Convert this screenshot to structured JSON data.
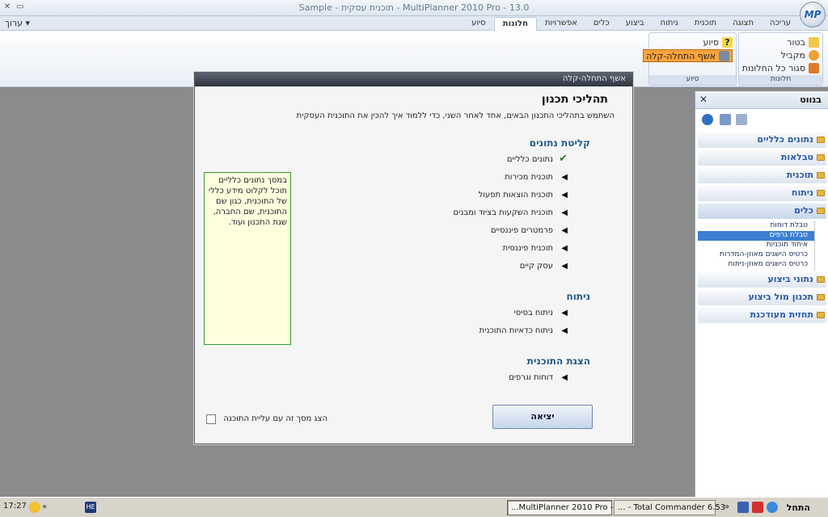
{
  "window": {
    "title": "Sample - תוכנית עסקית - MultiPlanner 2010 Pro - 13.0",
    "min_glyph": "▭",
    "close_glyph": "✕",
    "logo_text": "MP"
  },
  "menu": {
    "edit_label": "ערוך ▾"
  },
  "tabs": [
    {
      "label": "עריכה",
      "active": false
    },
    {
      "label": "תצוגה",
      "active": false
    },
    {
      "label": "תוכנית",
      "active": false
    },
    {
      "label": "ניתוח",
      "active": false
    },
    {
      "label": "ביצוע",
      "active": false
    },
    {
      "label": "כלים",
      "active": false
    },
    {
      "label": "אפשרויות",
      "active": false
    },
    {
      "label": "חלונות",
      "active": true
    },
    {
      "label": "סיוע",
      "active": false
    }
  ],
  "ribbon": {
    "windows_group": {
      "label": "חלונות",
      "items": [
        "בטור",
        "מקביל",
        "סגור כל החלונות"
      ]
    },
    "help_group": {
      "label": "סיוע",
      "items": [
        "סיוע",
        "אשף התחלה-קלה"
      ]
    }
  },
  "pane": {
    "title": "בנווט",
    "close_glyph": "✕",
    "groups": [
      {
        "label": "נתונים כלליים"
      },
      {
        "label": "טבלאות"
      },
      {
        "label": "תוכנית"
      },
      {
        "label": "ניתוח"
      },
      {
        "label": "כלים",
        "open": true
      }
    ],
    "sub_items": [
      {
        "label": "טבלת דוחות",
        "selected": false
      },
      {
        "label": "טבלת גרפים",
        "selected": true
      },
      {
        "label": "איחוד תוכניות",
        "selected": false
      },
      {
        "label": "כרטיס הישגים מאוזן-המדרות",
        "selected": false
      },
      {
        "label": "כרטיס הישגים מאוזן-ניתוח",
        "selected": false
      }
    ],
    "groups_after": [
      {
        "label": "נתוני ביצוע"
      },
      {
        "label": "תכנון מול ביצוע"
      },
      {
        "label": "תחזית מעודכנת"
      }
    ]
  },
  "dialog": {
    "title": "אשף התחלה-קלה",
    "heading": "תהליכי תכנון",
    "intro": "השתמש בתהליכי התכנון הבאים, אחד לאחר השני, כדי ללמוד איך להכין את התוכנית העסקית",
    "sections": [
      {
        "title": "קליטת נתונים",
        "steps": [
          {
            "label": "נתונים כלליים",
            "done": true
          },
          {
            "label": "תוכנית מכירות",
            "done": false
          },
          {
            "label": "תוכנית הוצאות תפעול",
            "done": false
          },
          {
            "label": "תוכנית השקעות בציוד ומבנים",
            "done": false
          },
          {
            "label": "פרמטרים פיננסיים",
            "done": false
          },
          {
            "label": "תוכנית פיננסית",
            "done": false
          },
          {
            "label": "עסק קיים",
            "done": false
          }
        ]
      },
      {
        "title": "ניתוח",
        "steps": [
          {
            "label": "ניתוח בסיסי",
            "done": false
          },
          {
            "label": "ניתוח כדאיות התוכנית",
            "done": false
          }
        ]
      },
      {
        "title": "הצגת התוכנית",
        "steps": [
          {
            "label": "דוחות וגרפים",
            "done": false
          }
        ]
      }
    ],
    "done_glyph": "✔",
    "arrow_glyph": "◀",
    "info_text": "במסך נתונים כלליים תוכל לקלוט מידע כללי של התוכנית, כגון שם התוכנית, שם החברה, שנת התכנון ועוד.",
    "exit_label": "יציאה",
    "checkbox_label": "הצג מסך זה עם עליית התוכנה",
    "checkbox_checked": false
  },
  "taskbar": {
    "clock": "17:27",
    "start_label": "התחל",
    "chevron": "«",
    "buttons": [
      {
        "label": "...MultiPlanner 2010 Pro - 1",
        "pressed": true
      },
      {
        "label": "... - Total Commander 6.53",
        "pressed": false
      }
    ],
    "he_label": "HE"
  },
  "colors": {
    "accent": "#1f5b8a",
    "highlight": "#f8a33e",
    "selection": "#3c7fd2",
    "pane_link": "#2a5aa8"
  }
}
